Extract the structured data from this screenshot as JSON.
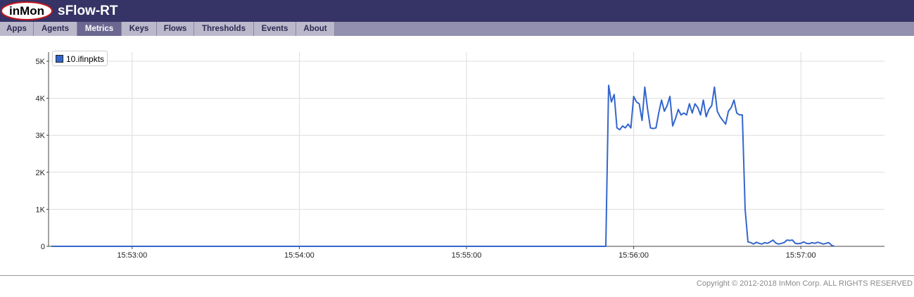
{
  "header": {
    "logo_text": "inMon",
    "app_title": "sFlow-RT"
  },
  "nav": {
    "tabs": [
      {
        "label": "Apps"
      },
      {
        "label": "Agents"
      },
      {
        "label": "Metrics",
        "active": true
      },
      {
        "label": "Keys"
      },
      {
        "label": "Flows"
      },
      {
        "label": "Thresholds"
      },
      {
        "label": "Events"
      },
      {
        "label": "About"
      }
    ]
  },
  "colors": {
    "header_bg": "#363366",
    "series_line": "#3366cc",
    "active_tab": "#6b6790"
  },
  "chart_data": {
    "type": "line",
    "legend_position": "top-left",
    "grid": true,
    "ylim": [
      0,
      5000
    ],
    "y_ticks": [
      "0",
      "1K",
      "2K",
      "3K",
      "4K",
      "5K"
    ],
    "x_ticks": [
      "15:53:00",
      "15:54:00",
      "15:55:00",
      "15:56:00",
      "15:57:00"
    ],
    "xlim": [
      "15:52:30",
      "15:57:30"
    ],
    "series": [
      {
        "name": "10.ifinpkts",
        "x": [
          "15:52:31",
          "15:55:50",
          "15:55:51",
          "15:55:52",
          "15:55:53",
          "15:55:54",
          "15:55:55",
          "15:55:56",
          "15:55:57",
          "15:55:58",
          "15:55:59",
          "15:56:00",
          "15:56:01",
          "15:56:02",
          "15:56:03",
          "15:56:04",
          "15:56:05",
          "15:56:06",
          "15:56:07",
          "15:56:08",
          "15:56:09",
          "15:56:10",
          "15:56:11",
          "15:56:12",
          "15:56:13",
          "15:56:14",
          "15:56:15",
          "15:56:16",
          "15:56:17",
          "15:56:18",
          "15:56:19",
          "15:56:20",
          "15:56:21",
          "15:56:22",
          "15:56:23",
          "15:56:24",
          "15:56:25",
          "15:56:26",
          "15:56:27",
          "15:56:28",
          "15:56:29",
          "15:56:30",
          "15:56:31",
          "15:56:32",
          "15:56:33",
          "15:56:34",
          "15:56:35",
          "15:56:36",
          "15:56:37",
          "15:56:38",
          "15:56:39",
          "15:56:40",
          "15:56:41",
          "15:56:42",
          "15:56:43",
          "15:56:44",
          "15:56:45",
          "15:56:46",
          "15:56:47",
          "15:56:48",
          "15:56:49",
          "15:56:50",
          "15:56:51",
          "15:56:52",
          "15:56:53",
          "15:56:54",
          "15:56:55",
          "15:56:56",
          "15:56:57",
          "15:56:58",
          "15:56:59",
          "15:57:00",
          "15:57:01",
          "15:57:02",
          "15:57:03",
          "15:57:04",
          "15:57:05",
          "15:57:06",
          "15:57:07",
          "15:57:08",
          "15:57:09",
          "15:57:10",
          "15:57:11",
          "15:57:12"
        ],
        "values": [
          0,
          0,
          4350,
          3900,
          4100,
          3200,
          3150,
          3250,
          3200,
          3300,
          3200,
          4050,
          3900,
          3850,
          3400,
          4300,
          3700,
          3200,
          3180,
          3200,
          3600,
          3950,
          3650,
          3800,
          4050,
          3250,
          3450,
          3700,
          3550,
          3600,
          3550,
          3850,
          3600,
          3850,
          3750,
          3550,
          3950,
          3500,
          3700,
          3800,
          4300,
          3650,
          3500,
          3400,
          3300,
          3650,
          3750,
          3950,
          3600,
          3550,
          3550,
          1000,
          120,
          100,
          60,
          110,
          80,
          60,
          100,
          80,
          120,
          170,
          90,
          60,
          80,
          100,
          170,
          160,
          170,
          80,
          70,
          80,
          120,
          80,
          70,
          100,
          80,
          110,
          90,
          60,
          80,
          100,
          30,
          0
        ]
      }
    ]
  },
  "footer": {
    "copyright": "Copyright © 2012-2018 InMon Corp. ALL RIGHTS RESERVED"
  }
}
